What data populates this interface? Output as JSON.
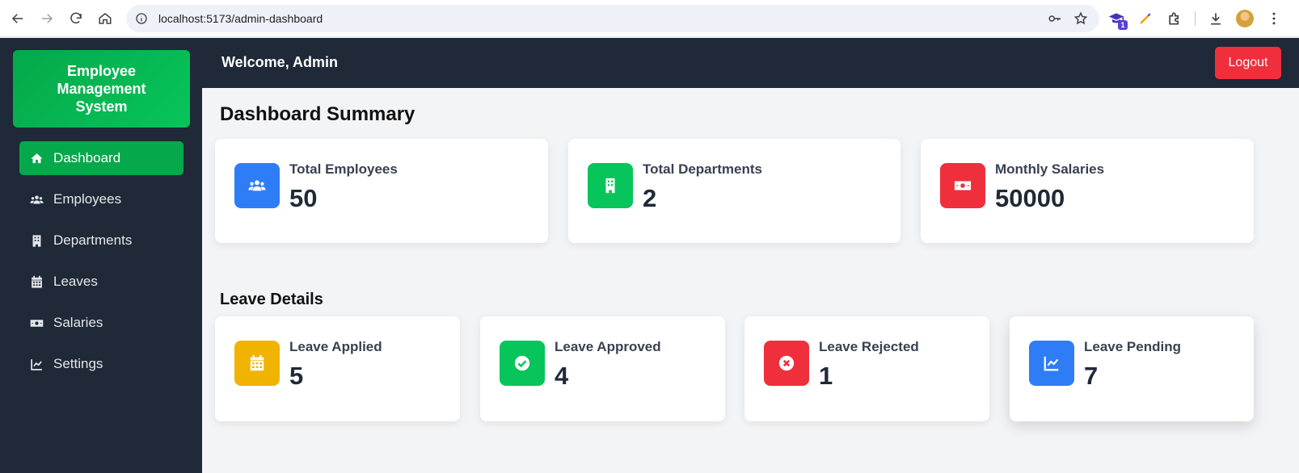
{
  "browser": {
    "url": "localhost:5173/admin-dashboard",
    "extension_badge": "1"
  },
  "sidebar": {
    "brand": "Employee Management System",
    "items": [
      {
        "label": "Dashboard",
        "icon": "home-icon"
      },
      {
        "label": "Employees",
        "icon": "users-icon"
      },
      {
        "label": "Departments",
        "icon": "building-icon"
      },
      {
        "label": "Leaves",
        "icon": "calendar-icon"
      },
      {
        "label": "Salaries",
        "icon": "money-icon"
      },
      {
        "label": "Settings",
        "icon": "chart-line-icon"
      }
    ]
  },
  "topbar": {
    "welcome": "Welcome, Admin",
    "logout_label": "Logout"
  },
  "summary": {
    "title": "Dashboard Summary",
    "cards": [
      {
        "label": "Total Employees",
        "value": "50",
        "color": "#2f7df6",
        "icon": "users-icon"
      },
      {
        "label": "Total Departments",
        "value": "2",
        "color": "#07c55a",
        "icon": "building-icon"
      },
      {
        "label": "Monthly Salaries",
        "value": "50000",
        "color": "#ef2f3c",
        "icon": "money-icon"
      }
    ]
  },
  "leave": {
    "title": "Leave Details",
    "cards": [
      {
        "label": "Leave Applied",
        "value": "5",
        "color": "#f0b400",
        "icon": "calendar-icon"
      },
      {
        "label": "Leave Approved",
        "value": "4",
        "color": "#07c55a",
        "icon": "check-circle-icon"
      },
      {
        "label": "Leave Rejected",
        "value": "1",
        "color": "#ef2f3c",
        "icon": "x-circle-icon"
      },
      {
        "label": "Leave Pending",
        "value": "7",
        "color": "#2f7df6",
        "icon": "chart-line-icon"
      }
    ]
  }
}
